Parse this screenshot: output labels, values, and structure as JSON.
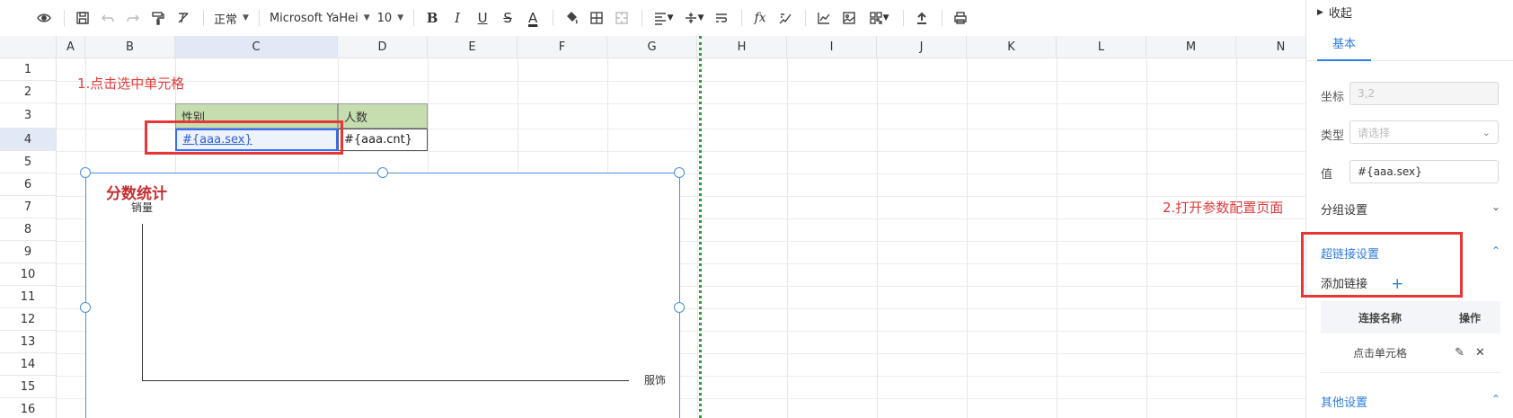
{
  "toolbar": {
    "number_format": "正常",
    "font_family": "Microsoft YaHei",
    "font_size": "10"
  },
  "sheet": {
    "columns": [
      "A",
      "B",
      "C",
      "D",
      "E",
      "F",
      "G",
      "H",
      "I",
      "J",
      "K",
      "L",
      "M",
      "N"
    ],
    "rows": [
      "1",
      "2",
      "3",
      "4",
      "5",
      "6",
      "7",
      "8",
      "9",
      "10",
      "11",
      "12",
      "13",
      "14",
      "15",
      "16"
    ],
    "cells": {
      "C3": "性别",
      "D3": "人数",
      "C4": "#{aaa.sex}",
      "D4": "#{aaa.cnt}"
    },
    "annotation_step1": "1.点击选中单元格",
    "annotation_step2": "2.打开参数配置页面"
  },
  "chart": {
    "title": "分数统计",
    "ylabel": "销量",
    "xlabel": "服饰"
  },
  "chart_data": {
    "type": "bar",
    "title": "分数统计",
    "ylabel": "销量",
    "xlabel": "服饰",
    "categories": [],
    "values": []
  },
  "panel": {
    "collapse_label": "收起",
    "tab_basic": "基本",
    "coord_label": "坐标",
    "coord_value": "3,2",
    "type_label": "类型",
    "type_placeholder": "请选择",
    "value_label": "值",
    "value_value": "#{aaa.sex}",
    "group_settings": "分组设置",
    "hyperlink_settings": "超链接设置",
    "add_link": "添加链接",
    "table_headers": {
      "name": "连接名称",
      "action": "操作"
    },
    "links": [
      {
        "name": "点击单元格"
      }
    ],
    "other_settings": "其他设置"
  }
}
